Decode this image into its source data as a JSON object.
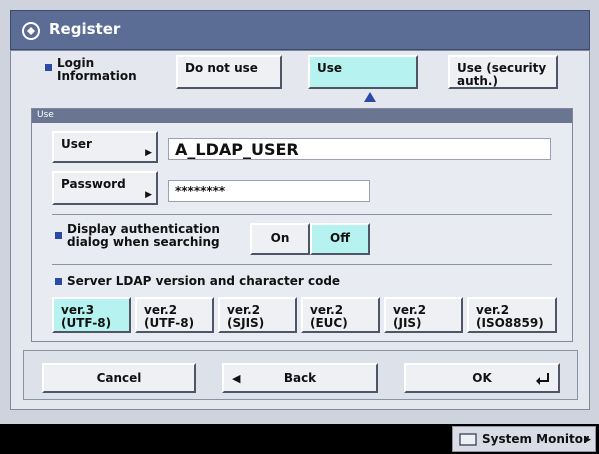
{
  "window": {
    "title": "Register"
  },
  "login": {
    "label_line1": "Login",
    "label_line2": "Information",
    "options": [
      "Do not use",
      "Use",
      "Use (security",
      "auth.)"
    ],
    "selected": "Use"
  },
  "section": {
    "title": "Use"
  },
  "user": {
    "button": "User",
    "value": "A_LDAP_USER"
  },
  "password": {
    "button": "Password",
    "value": "********"
  },
  "auth_dialog": {
    "label_line1": "Display authentication",
    "label_line2": "dialog when searching",
    "on": "On",
    "off": "Off",
    "selected": "Off"
  },
  "ldap": {
    "label": "Server LDAP version and character code",
    "versions": [
      {
        "line1": "ver.3",
        "line2": "(UTF-8)"
      },
      {
        "line1": "ver.2",
        "line2": "(UTF-8)"
      },
      {
        "line1": "ver.2",
        "line2": "(SJIS)"
      },
      {
        "line1": "ver.2",
        "line2": "(EUC)"
      },
      {
        "line1": "ver.2",
        "line2": "(JIS)"
      },
      {
        "line1": "ver.2",
        "line2": "(ISO8859)"
      }
    ],
    "selected_index": 0
  },
  "footer": {
    "cancel": "Cancel",
    "back": "Back",
    "ok": "OK"
  },
  "system_monitor": {
    "label": "System Monitor"
  },
  "colors": {
    "selected": "#b6f2f0",
    "title_bar": "#5b6c95",
    "bullet": "#2b4aa6"
  },
  "icons": [
    "register-icon",
    "arrow-up-indicator-icon",
    "submenu-arrow-icon",
    "back-arrow-icon",
    "enter-icon",
    "monitor-icon",
    "chevron-right-icon"
  ]
}
